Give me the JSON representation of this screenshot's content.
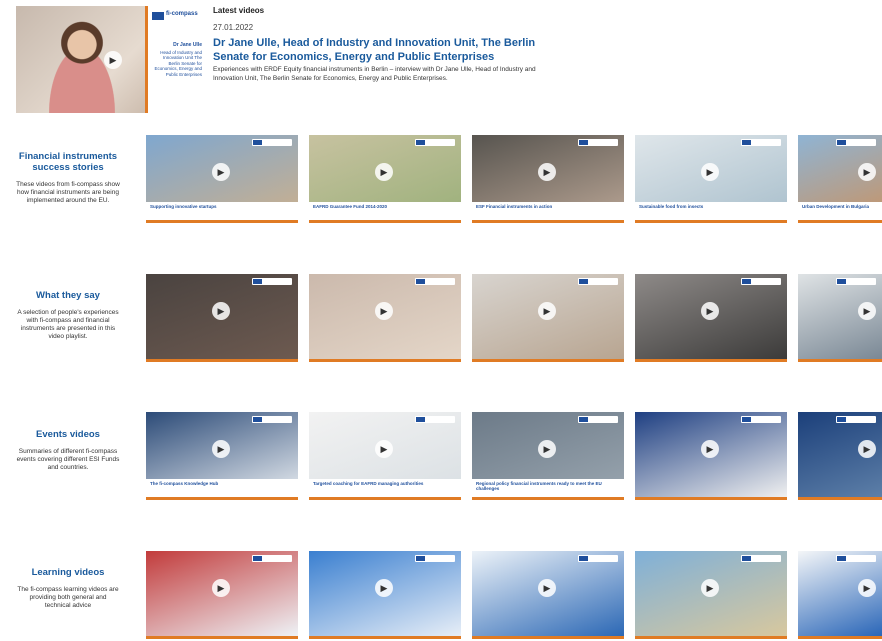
{
  "featured": {
    "section_label": "Latest videos",
    "date": "27.01.2022",
    "title": "Dr Jane Ulle, Head of Industry and Innovation Unit, The Berlin Senate for Economics, Energy and Public Enterprises",
    "description": "Experiences with ERDF Equity financial instruments in Berlin – interview with Dr Jane Ulle, Head of Industry and Innovation Unit, The Berlin Senate for Economics, Energy and Public Enterprises.",
    "thumb_brand": "fi-compass",
    "thumb_name": "Dr Jane Ulle",
    "thumb_role": "Head of Industry and Innovation Unit The Berlin Senate for Economics, Energy and Public Enterprises"
  },
  "rows": [
    {
      "title": "Financial instruments success stories",
      "description": "These videos from fi-compass show how financial instruments are being implemented around the EU.",
      "thumbs": [
        {
          "caption": "Supporting innovative startups",
          "color1": "#7fa7cf",
          "color2": "#cbb08d"
        },
        {
          "caption": "EAFRD Guarantee Fund 2014-2020",
          "color1": "#c7c2a0",
          "color2": "#9bb07a"
        },
        {
          "caption": "ESF Financial instruments in action",
          "color1": "#57544f",
          "color2": "#b8a494"
        },
        {
          "caption": "Sustainable food from insects",
          "color1": "#dfe6ea",
          "color2": "#a9bfcc"
        },
        {
          "caption": "Urban Development in Bulgaria",
          "color1": "#8fb4d4",
          "color2": "#c69468"
        }
      ]
    },
    {
      "title": "What they say",
      "description": "A selection of people's experiences with fi-compass and financial instruments are presented in this video playlist.",
      "thumbs": [
        {
          "caption": "",
          "color1": "#4a4340",
          "color2": "#6d5a50"
        },
        {
          "caption": "",
          "color1": "#cbb9ac",
          "color2": "#e4d6c8"
        },
        {
          "caption": "",
          "color1": "#d8d4cf",
          "color2": "#b8a591"
        },
        {
          "caption": "",
          "color1": "#8e8a88",
          "color2": "#3c3b3a"
        },
        {
          "caption": "",
          "color1": "#dfe3e5",
          "color2": "#7a8895"
        }
      ]
    },
    {
      "title": "Events videos",
      "description": "Summaries of different fi-compass events covering different ESI Funds and countries.",
      "thumbs": [
        {
          "caption": "The fi-compass Knowledge Hub",
          "color1": "#2c4b78",
          "color2": "#e9edf1"
        },
        {
          "caption": "Targeted coaching for EAFRD managing authorities",
          "color1": "#f2f2f2",
          "color2": "#d9dfe3"
        },
        {
          "caption": "Regional policy financial instruments ready to meet the EU challenges",
          "color1": "#6c7a88",
          "color2": "#9aa6b0"
        },
        {
          "caption": "",
          "color1": "#1e3f82",
          "color2": "#f0f0f0"
        },
        {
          "caption": "",
          "color1": "#1b3f7a",
          "color2": "#5d7fa8"
        }
      ]
    },
    {
      "title": "Learning videos",
      "description": "The fi-compass learning videos are providing both general and technical advice",
      "thumbs": [
        {
          "caption": "",
          "color1": "#c23b3b",
          "color2": "#eef2f6"
        },
        {
          "caption": "",
          "color1": "#3a7fd0",
          "color2": "#e7eef7"
        },
        {
          "caption": "",
          "color1": "#ecf2f8",
          "color2": "#2c68b5"
        },
        {
          "caption": "",
          "color1": "#7fb0d8",
          "color2": "#d8c89e"
        },
        {
          "caption": "",
          "color1": "#f4f6f8",
          "color2": "#2a66b8"
        }
      ]
    }
  ],
  "icons": {
    "play": "▶"
  }
}
